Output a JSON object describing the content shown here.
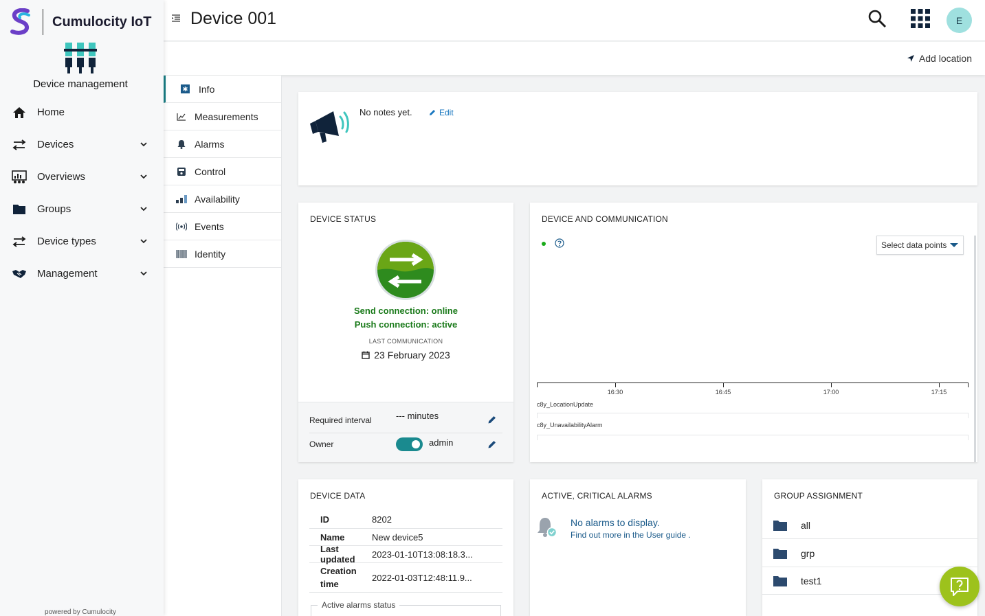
{
  "brand": {
    "name": "Cumulocity IoT"
  },
  "app": {
    "title": "Device management",
    "powered_by": "powered by Cumulocity"
  },
  "nav": {
    "items": [
      {
        "label": "Home"
      },
      {
        "label": "Devices"
      },
      {
        "label": "Overviews"
      },
      {
        "label": "Groups"
      },
      {
        "label": "Device types"
      },
      {
        "label": "Management"
      }
    ]
  },
  "header": {
    "title": "Device 001",
    "avatar_initial": "E",
    "add_location": "Add location"
  },
  "tabs": [
    {
      "label": "Info"
    },
    {
      "label": "Measurements"
    },
    {
      "label": "Alarms"
    },
    {
      "label": "Control"
    },
    {
      "label": "Availability"
    },
    {
      "label": "Events"
    },
    {
      "label": "Identity"
    }
  ],
  "notes": {
    "text": "No notes yet.",
    "edit_label": "Edit"
  },
  "device_status": {
    "title": "DEVICE STATUS",
    "send_connection": "Send connection: online",
    "push_connection": "Push connection: active",
    "last_comm_label": "LAST COMMUNICATION",
    "last_comm_value": "23 February 2023",
    "required_interval_label": "Required interval",
    "required_interval_value": "--- minutes",
    "owner_label": "Owner",
    "owner_value": "admin"
  },
  "comm": {
    "title": "DEVICE AND COMMUNICATION",
    "select_label": "Select data points",
    "ticks": [
      "16:30",
      "16:45",
      "17:00",
      "17:15"
    ],
    "series": [
      "c8y_LocationUpdate",
      "c8y_UnavailabilityAlarm"
    ]
  },
  "device_data": {
    "title": "DEVICE DATA",
    "rows": [
      {
        "key": "ID",
        "value": "8202"
      },
      {
        "key": "Name",
        "value": "New device5"
      },
      {
        "key": "Last updated",
        "value": "2023-01-10T13:08:18.3..."
      },
      {
        "key": "Creation time",
        "value": "2022-01-03T12:48:11.9..."
      }
    ],
    "alarms_status_legend": "Active alarms status"
  },
  "alarms": {
    "title": "ACTIVE, CRITICAL ALARMS",
    "empty": "No alarms to display.",
    "find_out": "Find out more in the User guide ."
  },
  "groups": {
    "title": "GROUP ASSIGNMENT",
    "items": [
      "all",
      "grp",
      "test1"
    ]
  },
  "colors": {
    "accent": "#1a7f86",
    "status_green": "#1a7a1a",
    "fab": "#9dc21c"
  }
}
